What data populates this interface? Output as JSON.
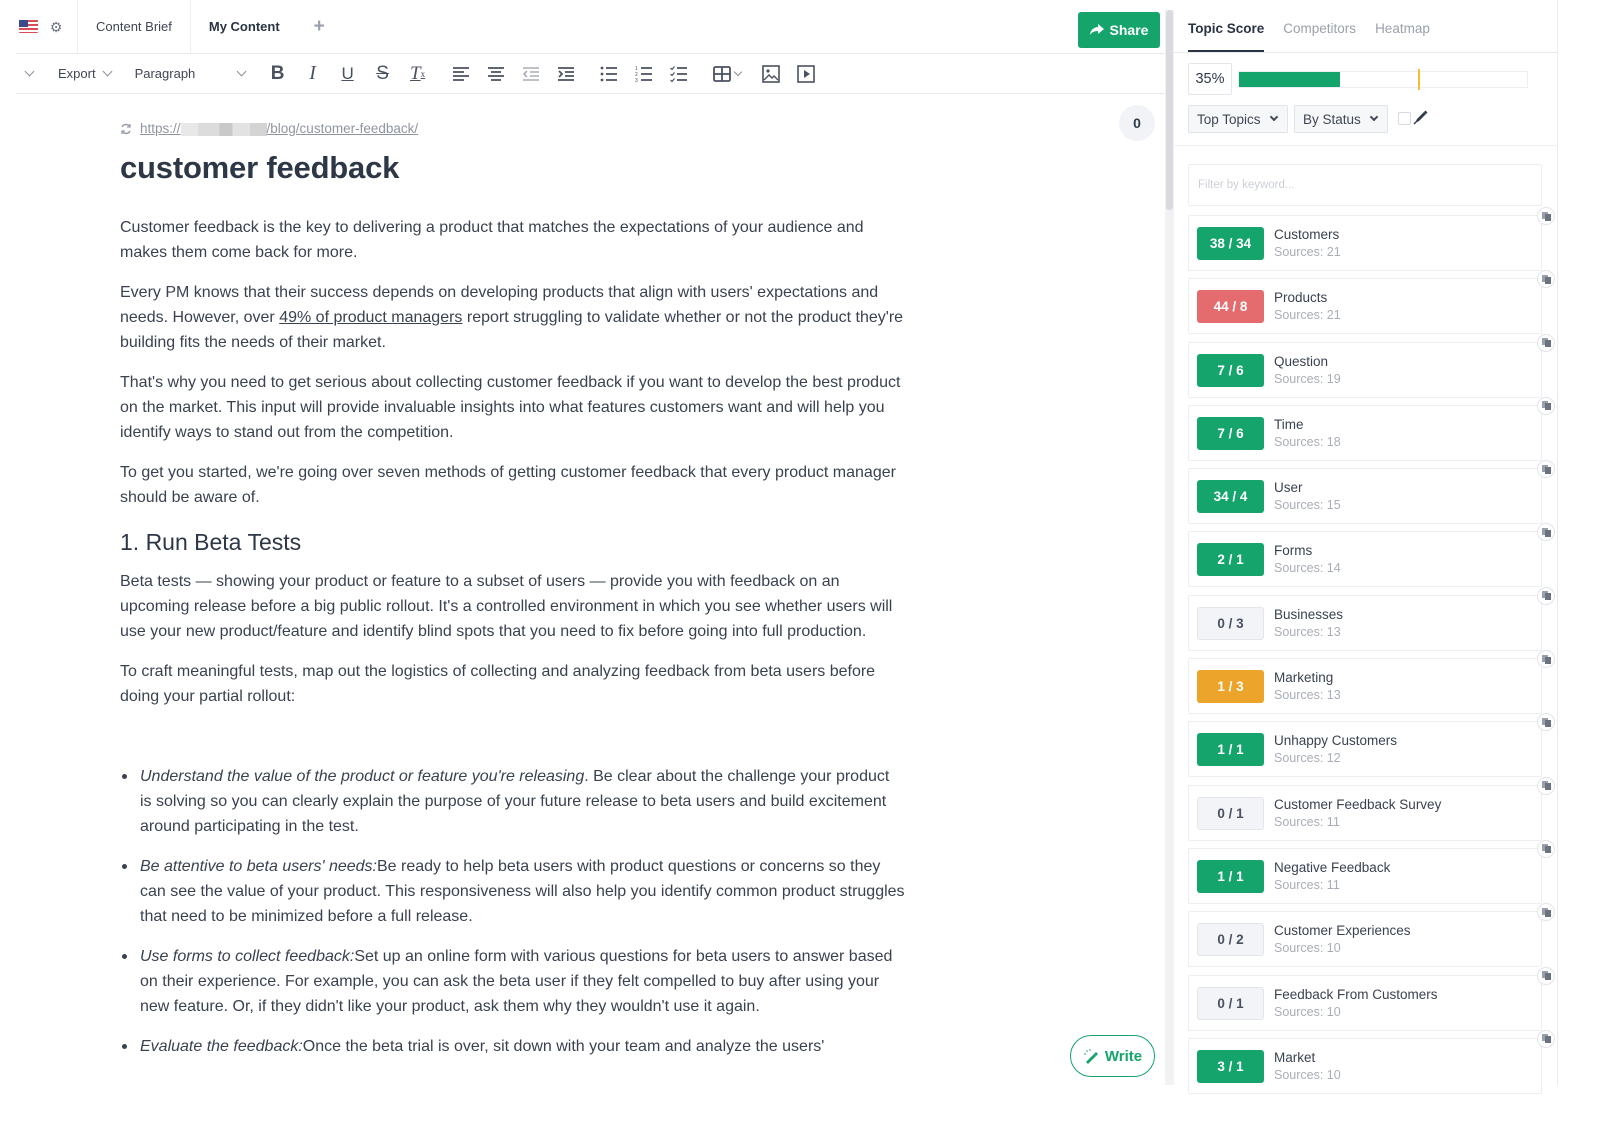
{
  "header": {
    "flag_icon": "us-flag-icon",
    "settings_icon": "gear-icon",
    "tabs": [
      {
        "label": "Content Brief",
        "active": false
      },
      {
        "label": "My Content",
        "active": true
      }
    ],
    "add_tab_icon": "plus-icon",
    "share_label": "Share",
    "share_icon": "share-arrow-icon"
  },
  "toolbar": {
    "collapse_icon": "chevron-down-icon",
    "export_label": "Export",
    "block_format": "Paragraph",
    "tools": [
      "bold-icon",
      "italic-icon",
      "underline-icon",
      "strikethrough-icon",
      "clear-format-icon",
      "align-left-icon",
      "align-center-icon",
      "outdent-icon",
      "indent-icon",
      "bullet-list-icon",
      "numbered-list-icon",
      "checklist-icon",
      "table-icon",
      "image-icon",
      "video-icon"
    ]
  },
  "document": {
    "url_prefix": "https://",
    "url_suffix": "/blog/customer-feedback/",
    "word_counter": "0",
    "title": "customer feedback",
    "p1": "Customer feedback is the key to delivering a product that matches the expectations of your audience and makes them come back for more.",
    "p2_before": "Every PM knows that their success depends on developing products that align with users' expectations and needs. However, over ",
    "p2_link": "49% of product managers",
    "p2_after": " report struggling to validate whether or not the product they're building fits the needs of their market.",
    "p3": "That's why you need to get serious about collecting customer feedback if you want to develop the best product on the market. This input will provide invaluable insights into what features customers want and will help you identify ways to stand out from the competition.",
    "p4": "To get you started, we're going over seven methods of getting customer feedback that every product manager should be aware of.",
    "h2": "1. Run Beta Tests",
    "p5": "Beta tests — showing your product or feature to a subset of users — provide you with feedback on an upcoming release before a big public rollout. It's a controlled environment in which you see whether users will use your new product/feature and identify blind spots that you need to fix before going into full production.",
    "p6": "To craft meaningful tests, map out the logistics of collecting and analyzing feedback from beta users before doing your partial rollout:",
    "bullets": [
      {
        "em": "Understand the value of the product or feature you're releasing",
        "text": ". Be clear about the challenge your product is solving so you can clearly explain the purpose of your future release to beta users and build excitement around participating in the test."
      },
      {
        "em": "Be attentive to beta users' needs:",
        "text": "Be ready to help beta users with product questions or concerns so they can see the value of your product. This responsiveness will also help you identify common product struggles that need to be minimized before a full release."
      },
      {
        "em": "Use forms to collect feedback:",
        "text": "Set up an online form with various questions for beta users to answer based on their experience. For example, you can ask the beta user if they felt compelled to buy after using your new feature. Or, if they didn't like your product, ask them why they wouldn't use it again."
      },
      {
        "em": "Evaluate the feedback:",
        "text": "Once the beta trial is over, sit down with your team and analyze the users'"
      }
    ],
    "write_label": "Write"
  },
  "panel": {
    "tabs": [
      {
        "label": "Topic Score",
        "active": true
      },
      {
        "label": "Competitors",
        "active": false
      },
      {
        "label": "Heatmap",
        "active": false
      }
    ],
    "score_label": "35%",
    "score_percent": 35,
    "target_percent": 62,
    "filter_topics": "Top Topics",
    "filter_status": "By Status",
    "filter_placeholder": "Filter by keyword...",
    "colors": {
      "green": "#14a46c",
      "red": "#e46b6e",
      "orange": "#eda42a",
      "gray": "#f3f4f7"
    },
    "topics": [
      {
        "score": "38 / 34",
        "status": "green",
        "name": "Customers",
        "sources": "Sources: 21"
      },
      {
        "score": "44 / 8",
        "status": "red",
        "name": "Products",
        "sources": "Sources: 21"
      },
      {
        "score": "7 / 6",
        "status": "green",
        "name": "Question",
        "sources": "Sources: 19"
      },
      {
        "score": "7 / 6",
        "status": "green",
        "name": "Time",
        "sources": "Sources: 18"
      },
      {
        "score": "34 / 4",
        "status": "green",
        "name": "User",
        "sources": "Sources: 15"
      },
      {
        "score": "2 / 1",
        "status": "green",
        "name": "Forms",
        "sources": "Sources: 14"
      },
      {
        "score": "0 / 3",
        "status": "gray",
        "name": "Businesses",
        "sources": "Sources: 13"
      },
      {
        "score": "1 / 3",
        "status": "orange",
        "name": "Marketing",
        "sources": "Sources: 13"
      },
      {
        "score": "1 / 1",
        "status": "green",
        "name": "Unhappy Customers",
        "sources": "Sources: 12"
      },
      {
        "score": "0 / 1",
        "status": "gray",
        "name": "Customer Feedback Survey",
        "sources": "Sources: 11"
      },
      {
        "score": "1 / 1",
        "status": "green",
        "name": "Negative Feedback",
        "sources": "Sources: 11"
      },
      {
        "score": "0 / 2",
        "status": "gray",
        "name": "Customer Experiences",
        "sources": "Sources: 10"
      },
      {
        "score": "0 / 1",
        "status": "gray",
        "name": "Feedback From Customers",
        "sources": "Sources: 10"
      },
      {
        "score": "3 / 1",
        "status": "green",
        "name": "Market",
        "sources": "Sources: 10"
      }
    ]
  }
}
